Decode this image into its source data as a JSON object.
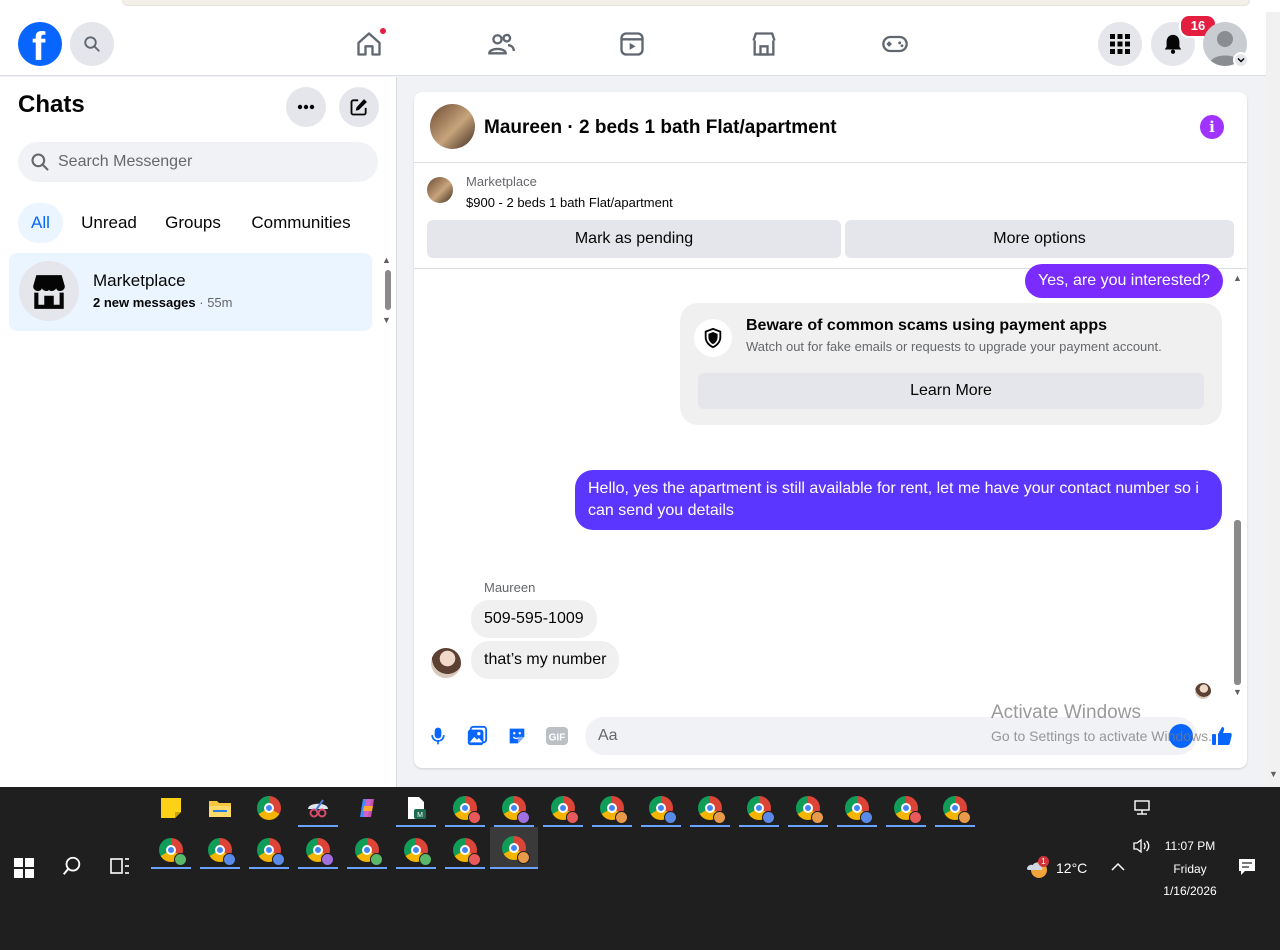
{
  "header": {
    "logo": "f",
    "notifications_count": "16",
    "nav_icons": [
      "home-icon",
      "friends-icon",
      "video-icon",
      "marketplace-icon",
      "gaming-icon"
    ]
  },
  "sidebar": {
    "title": "Chats",
    "search_placeholder": "Search Messenger",
    "tabs": [
      {
        "label": "All",
        "active": true
      },
      {
        "label": "Unread",
        "active": false
      },
      {
        "label": "Groups",
        "active": false
      },
      {
        "label": "Communities",
        "active": false
      }
    ],
    "chats": [
      {
        "name": "Marketplace",
        "preview": "2 new messages",
        "sep": " · ",
        "time": "55m"
      }
    ]
  },
  "conversation": {
    "title": "Maureen · 2 beds 1 bath Flat/apartment",
    "marketplace": {
      "label": "Marketplace",
      "detail": "$900 - 2 beds 1 bath Flat/apartment",
      "mark_pending": "Mark as pending",
      "more_options": "More options"
    },
    "messages": {
      "m1": "Yes, are you interested?",
      "scam_title": "Beware of common scams using payment apps",
      "scam_sub": "Watch out for fake emails or requests to upgrade your payment account.",
      "learn_more": "Learn More",
      "m2": "Hello, yes the apartment is still available for rent, let me have your contact number so i can send you details",
      "sender": "Maureen",
      "m3": "509-595-1009",
      "m4": "that’s my number"
    },
    "composer_placeholder": "Aa"
  },
  "watermark": {
    "line1": "Activate Windows",
    "line2": "Go to Settings to activate Windows."
  },
  "taskbar": {
    "temperature": "12°C",
    "weather_badge": "1",
    "time": "11:07 PM",
    "day": "Friday",
    "date": "1/16/2026"
  },
  "colors": {
    "fb_blue": "#0866ff",
    "outgoing_purple": "#7a2cff",
    "outgoing_indigo": "#5b36ff",
    "notif_red": "#e41e3f",
    "info_purple": "#a033ff"
  }
}
